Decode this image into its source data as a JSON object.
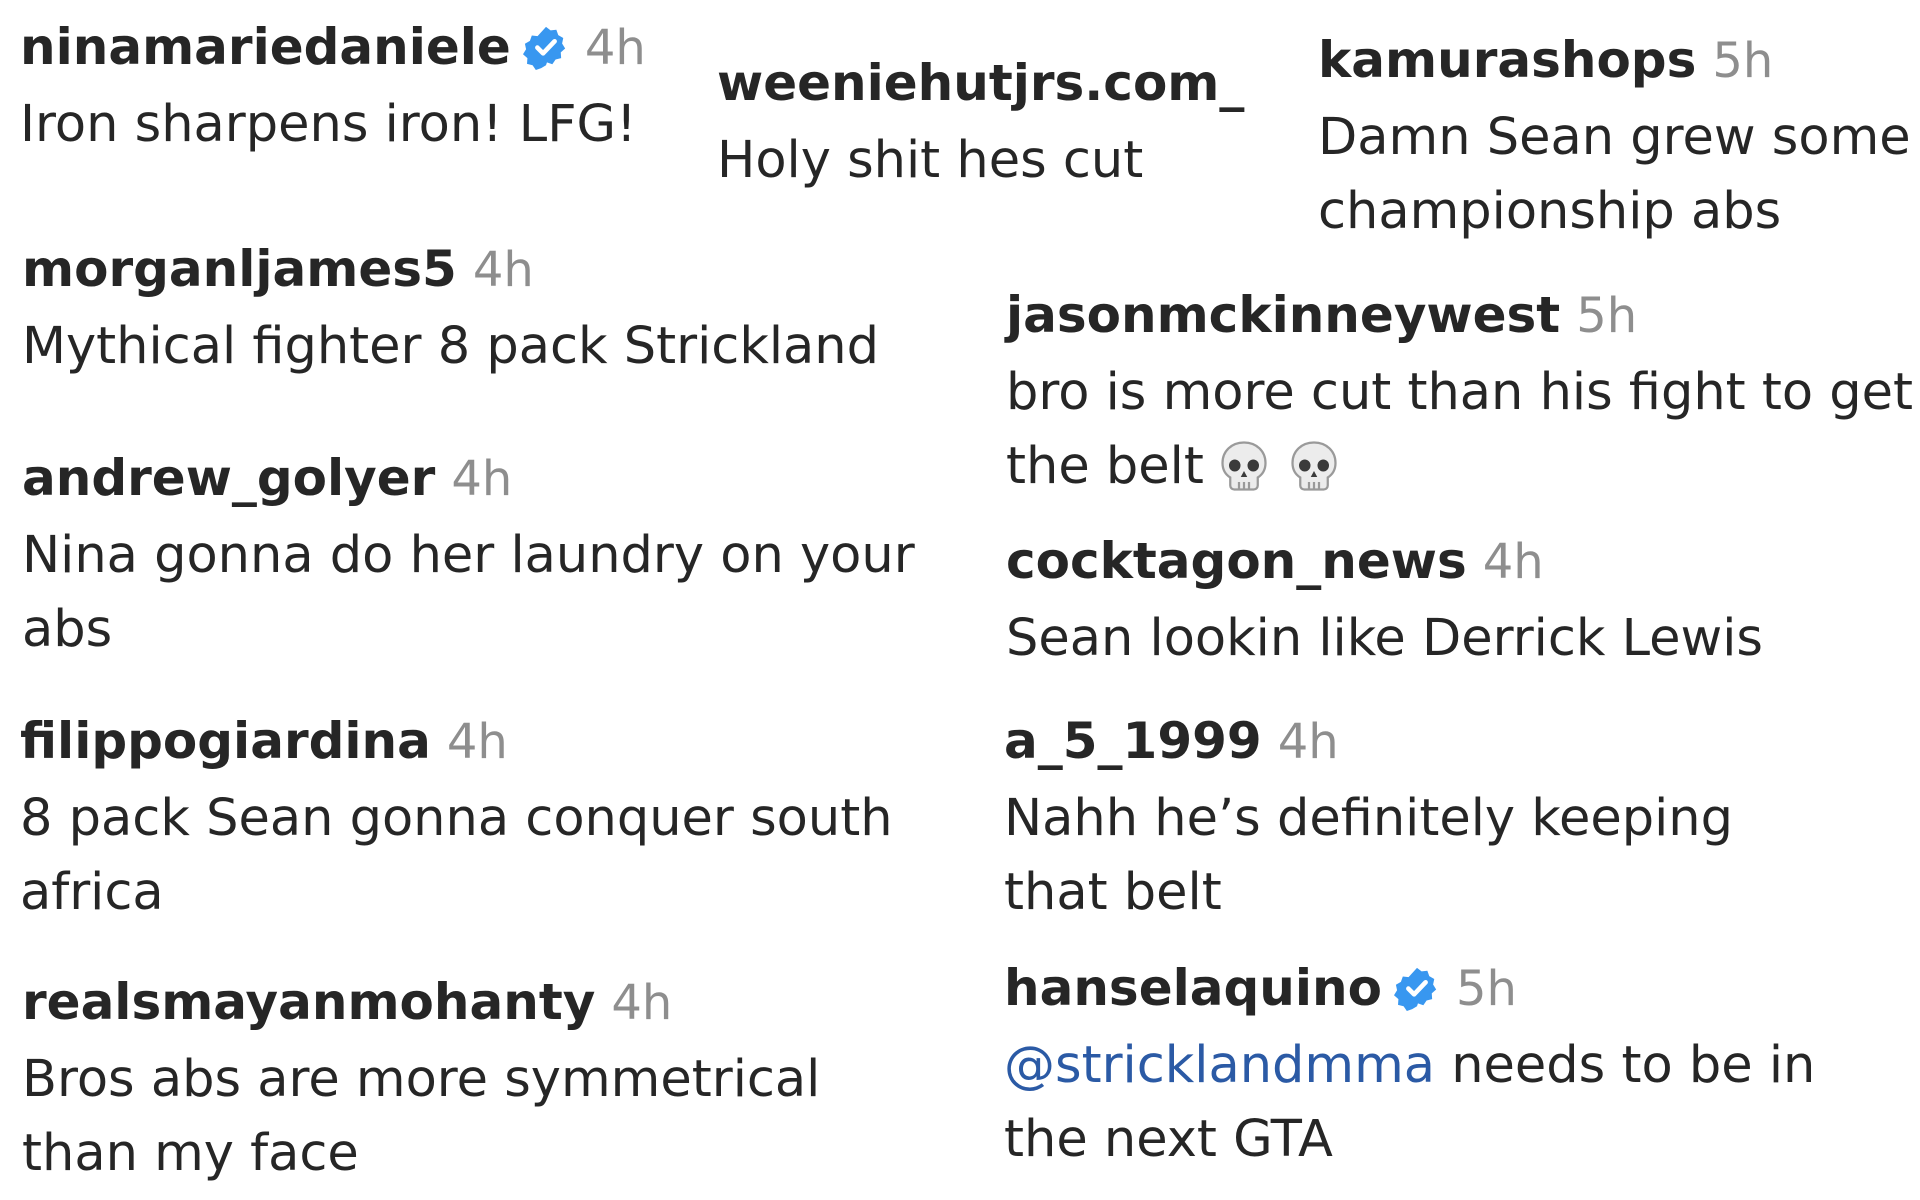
{
  "comments": [
    {
      "username": "ninamariedaniele",
      "verified": true,
      "time": "4h",
      "text": "Iron sharpens iron! LFG!"
    },
    {
      "username": "weeniehutjrs.com_",
      "verified": false,
      "time": "",
      "text": "Holy shit hes cut"
    },
    {
      "username": "kamurashops",
      "verified": false,
      "time": "5h",
      "text": "Damn Sean grew some championship abs"
    },
    {
      "username": "morganljames5",
      "verified": false,
      "time": "4h",
      "text": "Mythical fighter 8 pack Strickland"
    },
    {
      "username": "jasonmckinneywest",
      "verified": false,
      "time": "5h",
      "text": "bro is more cut than his fight to get the belt"
    },
    {
      "username": "andrew_golyer",
      "verified": false,
      "time": "4h",
      "text": "Nina gonna do her laundry on your abs"
    },
    {
      "username": "cocktagon_news",
      "verified": false,
      "time": "4h",
      "text": "Sean lookin like Derrick Lewis"
    },
    {
      "username": "filippogiardina",
      "verified": false,
      "time": "4h",
      "text": "8 pack Sean gonna conquer south africa"
    },
    {
      "username": "a_5_1999",
      "verified": false,
      "time": "4h",
      "text": "Nahh he’s definitely keeping that belt"
    },
    {
      "username": "realsmayanmohanty",
      "verified": false,
      "time": "4h",
      "text": "Bros abs are more symmetrical than my face"
    },
    {
      "username": "hanselaquino",
      "verified": true,
      "time": "5h",
      "mention": "@stricklandmma",
      "text": " needs to be in the next GTA"
    }
  ],
  "colors": {
    "verified_badge": "#3897f0",
    "mention": "#2b5aa5",
    "timestamp": "#8e8e8e"
  },
  "icons": {
    "verified": "verified-badge-icon",
    "emoji": "skull-emoji-icon"
  }
}
